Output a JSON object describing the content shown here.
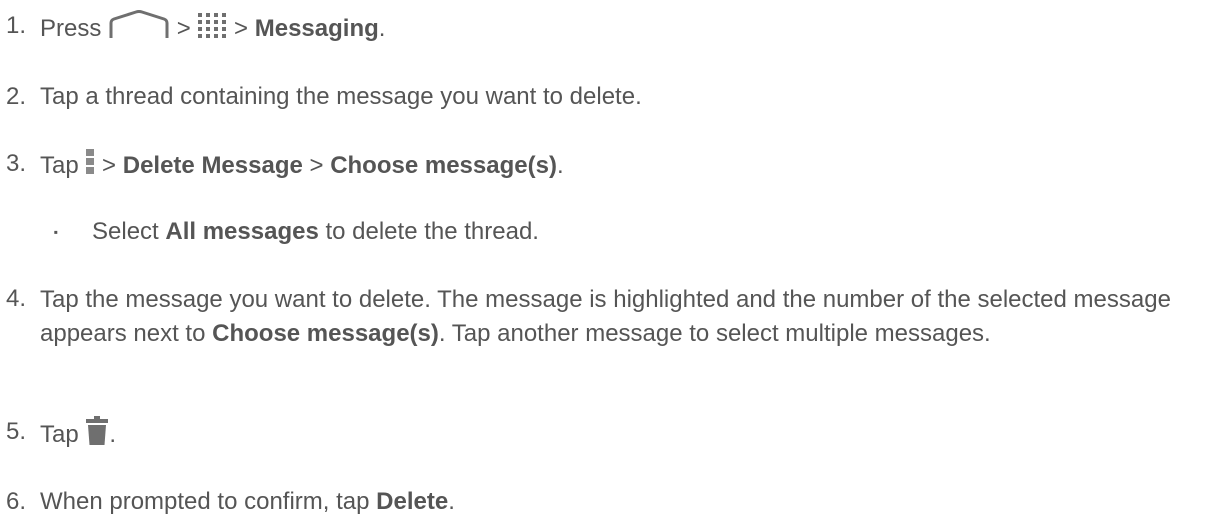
{
  "steps": [
    {
      "num": "1.",
      "t1": "Press ",
      "sep1": " > ",
      "sep2": " > ",
      "b1": "Messaging",
      "t_end": ".",
      "icon_home": "home-icon",
      "icon_apps": "apps-grid-icon"
    },
    {
      "num": "2.",
      "text": "Tap a thread containing the message you want to delete."
    },
    {
      "num": "3.",
      "t1": "Tap ",
      "sep1": " > ",
      "b1": "Delete Message",
      "sep2": " > ",
      "b2": "Choose message(s)",
      "t_end": ".",
      "icon_menu": "menu-icon"
    },
    {
      "num": "4.",
      "t1": "Tap the message you want to delete. The message is highlighted and the number of the selected message appears next to ",
      "b1": "Choose message(s)",
      "t2": ". Tap another message to select multiple messages."
    },
    {
      "num": "5.",
      "t1": "Tap ",
      "t_end": ".",
      "icon_trash": "trash-icon"
    },
    {
      "num": "6.",
      "t1": "When prompted to confirm, tap ",
      "b1": "Delete",
      "t_end": "."
    }
  ],
  "sub_bullet": {
    "mark": "▪",
    "t1": "Select ",
    "b1": "All messages",
    "t2": " to delete the thread."
  },
  "colors": {
    "text": "#555555",
    "icon": "#6f6f6f"
  }
}
